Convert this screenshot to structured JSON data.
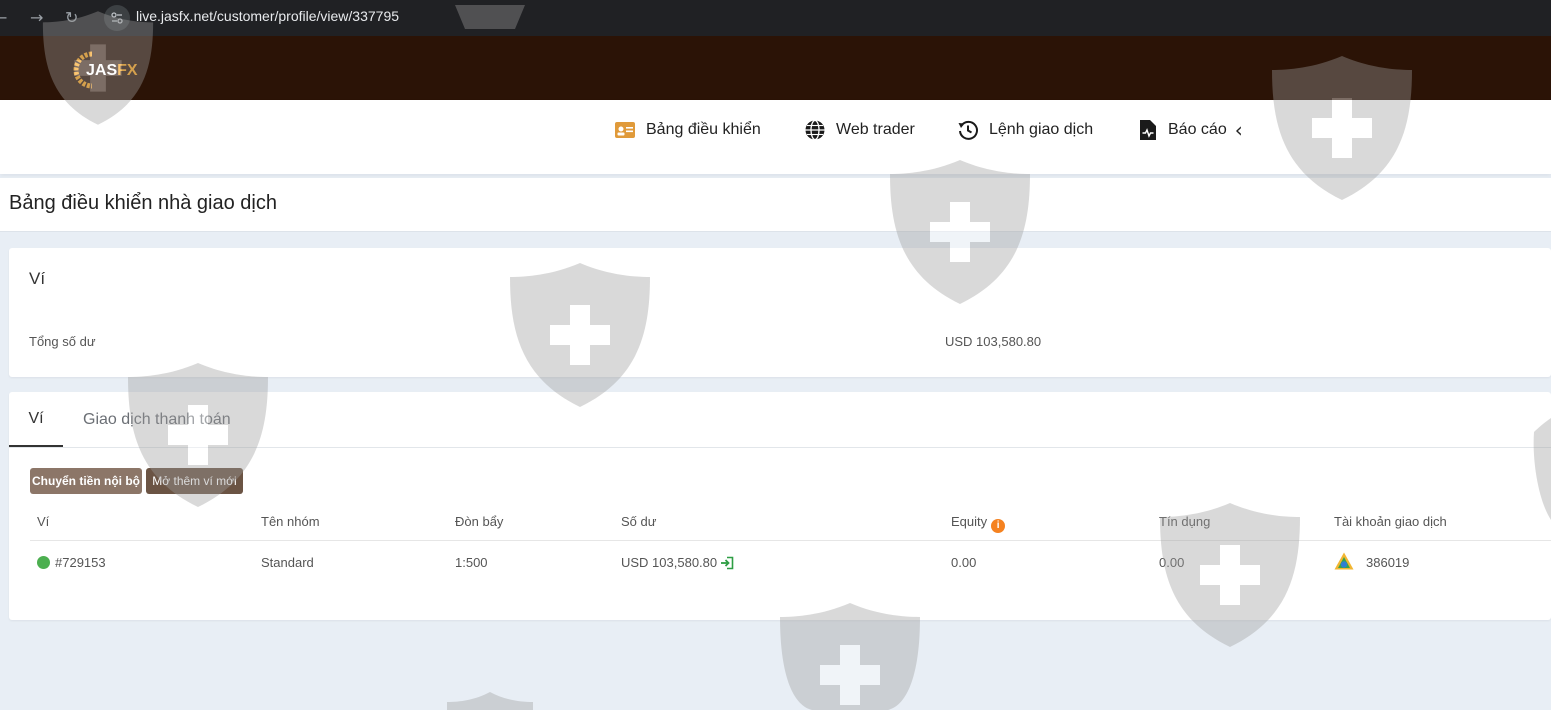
{
  "browser": {
    "url": "live.jasfx.net/customer/profile/view/337795",
    "back_glyph": "←",
    "forward_glyph": "→",
    "reload_glyph": "↻"
  },
  "brand": {
    "logo_text_a": "JAS",
    "logo_text_b": "FX",
    "accent": "#f7a21b",
    "header_color": "#2b1306"
  },
  "nav": {
    "items": [
      {
        "label": "Bảng điều khiển",
        "icon": "id-card-icon"
      },
      {
        "label": "Web trader",
        "icon": "globe-icon"
      },
      {
        "label": "Lệnh giao dịch",
        "icon": "history-icon"
      },
      {
        "label": "Báo cáo",
        "icon": "report-icon"
      }
    ],
    "collapse_glyph": "‹"
  },
  "page": {
    "title": "Bảng điều khiển nhà giao dịch"
  },
  "wallet_card": {
    "title": "Ví",
    "balance_label": "Tổng số dư",
    "balance_value": "USD 103,580.80"
  },
  "tabs": [
    {
      "label": "Ví",
      "active": true
    },
    {
      "label": "Giao dịch thanh toán",
      "active": false
    }
  ],
  "actions": {
    "transfer_label": "Chuyển tiền nội bộ",
    "open_wallet_label": "Mở thêm ví mới"
  },
  "table": {
    "headers": [
      "Ví",
      "Tên nhóm",
      "Đòn bẩy",
      "Số dư",
      "Equity",
      "Tín dụng",
      "Tài khoản giao dịch"
    ],
    "equity_info_glyph": "i",
    "rows": [
      {
        "wallet": "#729153",
        "status": "active",
        "group": "Standard",
        "leverage": "1:500",
        "balance": "USD 103,580.80",
        "equity": "0.00",
        "credit": "0.00",
        "trading_account": "386019"
      }
    ]
  }
}
